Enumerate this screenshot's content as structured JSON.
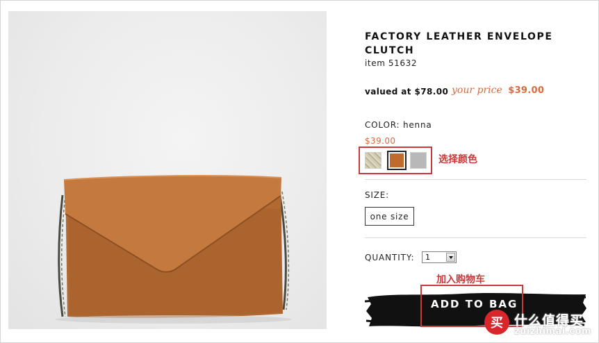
{
  "product": {
    "title": "FACTORY LEATHER ENVELOPE CLUTCH",
    "item_number": "item 51632",
    "valued_text": "valued at $78.00",
    "your_price_label": "your price",
    "your_price_value": "$39.00"
  },
  "color": {
    "label": "COLOR: henna",
    "price": "$39.00",
    "swatches": [
      {
        "name": "gold",
        "color": "#d2ccb2",
        "selected": false
      },
      {
        "name": "henna",
        "color": "#c06a2e",
        "selected": true
      },
      {
        "name": "silver",
        "color": "#b8b8b8",
        "selected": false
      }
    ],
    "annotation": "选择颜色"
  },
  "size": {
    "label": "SIZE:",
    "option": "one size"
  },
  "quantity": {
    "label": "QUANTITY:",
    "value": "1"
  },
  "add_to_bag": {
    "label": "ADD TO BAG",
    "annotation": "加入购物车"
  },
  "watermark": {
    "logo_char": "买",
    "text": "什么值得买",
    "url": "zuizhimai.com"
  },
  "colors": {
    "accent_price": "#d86a3e",
    "annotation_red": "#c9393a",
    "bag_black": "#111111"
  }
}
